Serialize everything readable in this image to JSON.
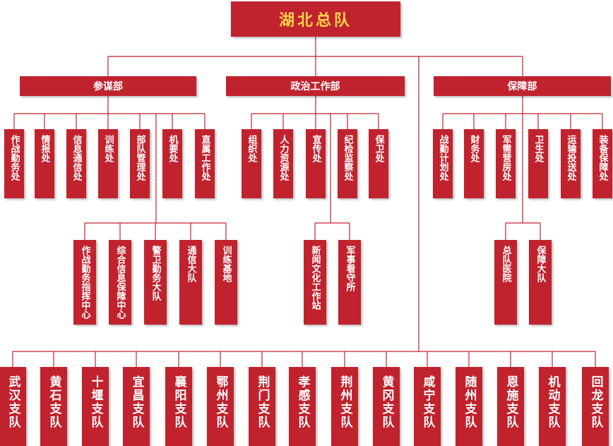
{
  "root": "湖北总队",
  "departments": [
    {
      "key": "canmou",
      "label": "参谋部",
      "offices": [
        "作战勤务处",
        "情报处",
        "信息通信处",
        "训练处",
        "部队管理处",
        "机要处",
        "直属工作处"
      ],
      "units": [
        "作战勤务指挥中心",
        "综合信息保障中心",
        "警卫勤务大队",
        "通信大队",
        "训练基地"
      ]
    },
    {
      "key": "zhengzhi",
      "label": "政治工作部",
      "offices": [
        "组织处",
        "人力资源处",
        "宣传处",
        "纪检监察处",
        "保卫处"
      ],
      "units": [
        "新闻文化工作站",
        "军事看守所"
      ]
    },
    {
      "key": "baozhang",
      "label": "保障部",
      "offices": [
        "战勤计划处",
        "财务处",
        "军需营房处",
        "卫生处",
        "运输投送处",
        "装备保障处"
      ],
      "units": [
        "总队医院",
        "保障大队"
      ]
    }
  ],
  "detachments": [
    "武汉支队",
    "黄石支队",
    "十堰支队",
    "宜昌支队",
    "襄阳支队",
    "鄂州支队",
    "荆门支队",
    "孝感支队",
    "荆州支队",
    "黄冈支队",
    "咸宁支队",
    "随州支队",
    "恩施支队",
    "机动支队",
    "回龙支队"
  ],
  "colors": {
    "box": "#c0232e",
    "text": "#ffffff",
    "root_text": "#ffd24a",
    "line": "#c0232e"
  }
}
